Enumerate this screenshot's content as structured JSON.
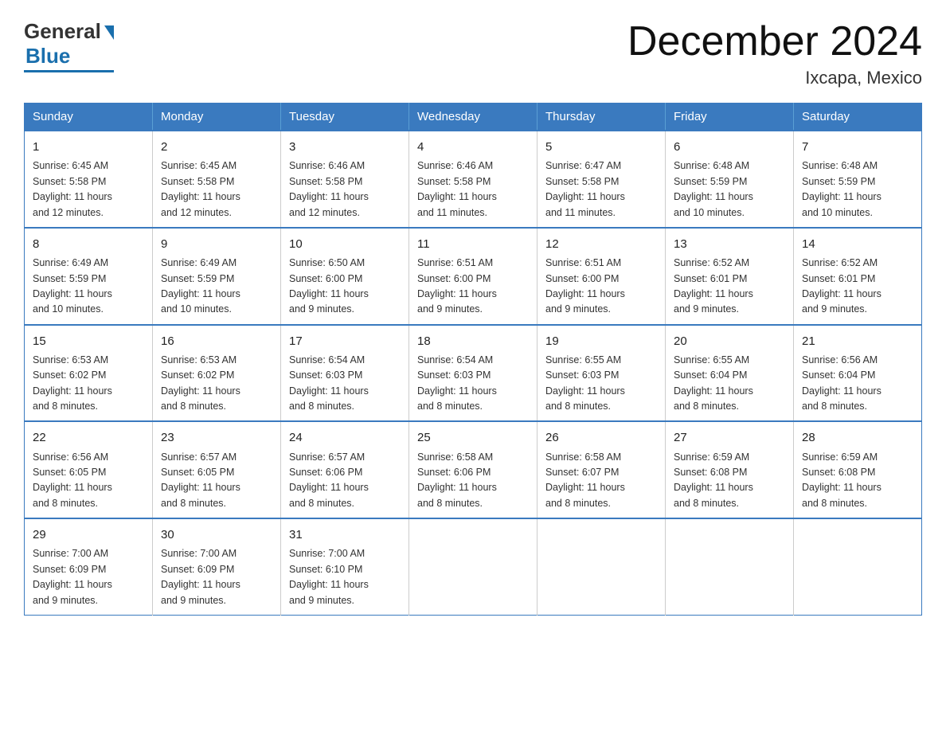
{
  "logo": {
    "general": "General",
    "blue": "Blue"
  },
  "header": {
    "month": "December 2024",
    "location": "Ixcapa, Mexico"
  },
  "weekdays": [
    "Sunday",
    "Monday",
    "Tuesday",
    "Wednesday",
    "Thursday",
    "Friday",
    "Saturday"
  ],
  "weeks": [
    [
      {
        "day": "1",
        "sunrise": "6:45 AM",
        "sunset": "5:58 PM",
        "daylight": "11 hours and 12 minutes."
      },
      {
        "day": "2",
        "sunrise": "6:45 AM",
        "sunset": "5:58 PM",
        "daylight": "11 hours and 12 minutes."
      },
      {
        "day": "3",
        "sunrise": "6:46 AM",
        "sunset": "5:58 PM",
        "daylight": "11 hours and 12 minutes."
      },
      {
        "day": "4",
        "sunrise": "6:46 AM",
        "sunset": "5:58 PM",
        "daylight": "11 hours and 11 minutes."
      },
      {
        "day": "5",
        "sunrise": "6:47 AM",
        "sunset": "5:58 PM",
        "daylight": "11 hours and 11 minutes."
      },
      {
        "day": "6",
        "sunrise": "6:48 AM",
        "sunset": "5:59 PM",
        "daylight": "11 hours and 10 minutes."
      },
      {
        "day": "7",
        "sunrise": "6:48 AM",
        "sunset": "5:59 PM",
        "daylight": "11 hours and 10 minutes."
      }
    ],
    [
      {
        "day": "8",
        "sunrise": "6:49 AM",
        "sunset": "5:59 PM",
        "daylight": "11 hours and 10 minutes."
      },
      {
        "day": "9",
        "sunrise": "6:49 AM",
        "sunset": "5:59 PM",
        "daylight": "11 hours and 10 minutes."
      },
      {
        "day": "10",
        "sunrise": "6:50 AM",
        "sunset": "6:00 PM",
        "daylight": "11 hours and 9 minutes."
      },
      {
        "day": "11",
        "sunrise": "6:51 AM",
        "sunset": "6:00 PM",
        "daylight": "11 hours and 9 minutes."
      },
      {
        "day": "12",
        "sunrise": "6:51 AM",
        "sunset": "6:00 PM",
        "daylight": "11 hours and 9 minutes."
      },
      {
        "day": "13",
        "sunrise": "6:52 AM",
        "sunset": "6:01 PM",
        "daylight": "11 hours and 9 minutes."
      },
      {
        "day": "14",
        "sunrise": "6:52 AM",
        "sunset": "6:01 PM",
        "daylight": "11 hours and 9 minutes."
      }
    ],
    [
      {
        "day": "15",
        "sunrise": "6:53 AM",
        "sunset": "6:02 PM",
        "daylight": "11 hours and 8 minutes."
      },
      {
        "day": "16",
        "sunrise": "6:53 AM",
        "sunset": "6:02 PM",
        "daylight": "11 hours and 8 minutes."
      },
      {
        "day": "17",
        "sunrise": "6:54 AM",
        "sunset": "6:03 PM",
        "daylight": "11 hours and 8 minutes."
      },
      {
        "day": "18",
        "sunrise": "6:54 AM",
        "sunset": "6:03 PM",
        "daylight": "11 hours and 8 minutes."
      },
      {
        "day": "19",
        "sunrise": "6:55 AM",
        "sunset": "6:03 PM",
        "daylight": "11 hours and 8 minutes."
      },
      {
        "day": "20",
        "sunrise": "6:55 AM",
        "sunset": "6:04 PM",
        "daylight": "11 hours and 8 minutes."
      },
      {
        "day": "21",
        "sunrise": "6:56 AM",
        "sunset": "6:04 PM",
        "daylight": "11 hours and 8 minutes."
      }
    ],
    [
      {
        "day": "22",
        "sunrise": "6:56 AM",
        "sunset": "6:05 PM",
        "daylight": "11 hours and 8 minutes."
      },
      {
        "day": "23",
        "sunrise": "6:57 AM",
        "sunset": "6:05 PM",
        "daylight": "11 hours and 8 minutes."
      },
      {
        "day": "24",
        "sunrise": "6:57 AM",
        "sunset": "6:06 PM",
        "daylight": "11 hours and 8 minutes."
      },
      {
        "day": "25",
        "sunrise": "6:58 AM",
        "sunset": "6:06 PM",
        "daylight": "11 hours and 8 minutes."
      },
      {
        "day": "26",
        "sunrise": "6:58 AM",
        "sunset": "6:07 PM",
        "daylight": "11 hours and 8 minutes."
      },
      {
        "day": "27",
        "sunrise": "6:59 AM",
        "sunset": "6:08 PM",
        "daylight": "11 hours and 8 minutes."
      },
      {
        "day": "28",
        "sunrise": "6:59 AM",
        "sunset": "6:08 PM",
        "daylight": "11 hours and 8 minutes."
      }
    ],
    [
      {
        "day": "29",
        "sunrise": "7:00 AM",
        "sunset": "6:09 PM",
        "daylight": "11 hours and 9 minutes."
      },
      {
        "day": "30",
        "sunrise": "7:00 AM",
        "sunset": "6:09 PM",
        "daylight": "11 hours and 9 minutes."
      },
      {
        "day": "31",
        "sunrise": "7:00 AM",
        "sunset": "6:10 PM",
        "daylight": "11 hours and 9 minutes."
      },
      null,
      null,
      null,
      null
    ]
  ],
  "labels": {
    "sunrise": "Sunrise:",
    "sunset": "Sunset:",
    "daylight": "Daylight:"
  }
}
